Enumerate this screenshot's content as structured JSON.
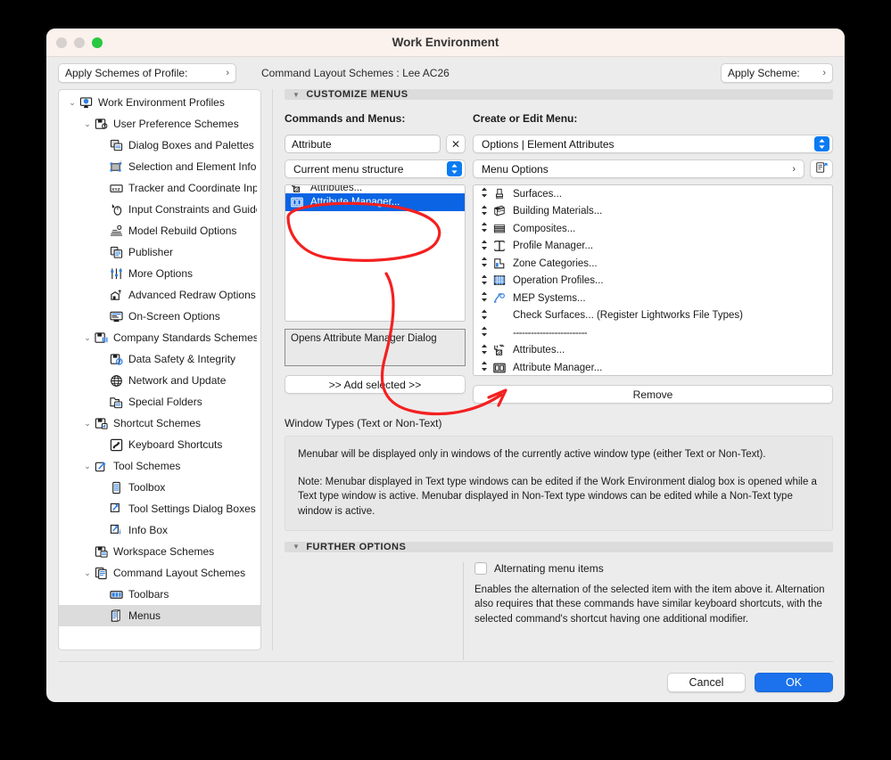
{
  "window": {
    "title": "Work Environment",
    "traffic_lights": [
      "close-gray",
      "minimize-gray",
      "zoom-green"
    ]
  },
  "toolbar": {
    "apply_profile_label": "Apply Schemes of Profile:",
    "apply_scheme_label": "Apply Scheme:",
    "scheme_breadcrumb": "Command Layout Schemes :  Lee AC26",
    "chevron": "›"
  },
  "sidebar": {
    "items": [
      {
        "label": "Work Environment Profiles",
        "indent": 0,
        "disclosure": "⌄",
        "icon": "work-environment-profiles-icon",
        "selected": false
      },
      {
        "label": "User Preference Schemes",
        "indent": 1,
        "disclosure": "⌄",
        "icon": "user-preference-schemes-icon",
        "selected": false
      },
      {
        "label": "Dialog Boxes and Palettes",
        "indent": 2,
        "disclosure": "",
        "icon": "dialog-boxes-palettes-icon",
        "selected": false
      },
      {
        "label": "Selection and Element Information",
        "indent": 2,
        "disclosure": "",
        "icon": "selection-element-info-icon",
        "selected": false
      },
      {
        "label": "Tracker and Coordinate Input",
        "indent": 2,
        "disclosure": "",
        "icon": "tracker-coordinate-input-icon",
        "selected": false
      },
      {
        "label": "Input Constraints and Guides",
        "indent": 2,
        "disclosure": "",
        "icon": "input-constraints-guides-icon",
        "selected": false
      },
      {
        "label": "Model Rebuild Options",
        "indent": 2,
        "disclosure": "",
        "icon": "model-rebuild-options-icon",
        "selected": false
      },
      {
        "label": "Publisher",
        "indent": 2,
        "disclosure": "",
        "icon": "publisher-icon",
        "selected": false
      },
      {
        "label": "More Options",
        "indent": 2,
        "disclosure": "",
        "icon": "more-options-icon",
        "selected": false
      },
      {
        "label": "Advanced Redraw Options",
        "indent": 2,
        "disclosure": "",
        "icon": "advanced-redraw-options-icon",
        "selected": false
      },
      {
        "label": "On-Screen Options",
        "indent": 2,
        "disclosure": "",
        "icon": "on-screen-options-icon",
        "selected": false
      },
      {
        "label": "Company Standards Schemes",
        "indent": 1,
        "disclosure": "⌄",
        "icon": "company-standards-schemes-icon",
        "selected": false
      },
      {
        "label": "Data Safety & Integrity",
        "indent": 2,
        "disclosure": "",
        "icon": "data-safety-integrity-icon",
        "selected": false
      },
      {
        "label": "Network and Update",
        "indent": 2,
        "disclosure": "",
        "icon": "network-update-icon",
        "selected": false
      },
      {
        "label": "Special Folders",
        "indent": 2,
        "disclosure": "",
        "icon": "special-folders-icon",
        "selected": false
      },
      {
        "label": "Shortcut Schemes",
        "indent": 1,
        "disclosure": "⌄",
        "icon": "shortcut-schemes-icon",
        "selected": false
      },
      {
        "label": "Keyboard Shortcuts",
        "indent": 2,
        "disclosure": "",
        "icon": "keyboard-shortcuts-icon",
        "selected": false
      },
      {
        "label": "Tool Schemes",
        "indent": 1,
        "disclosure": "⌄",
        "icon": "tool-schemes-icon",
        "selected": false
      },
      {
        "label": "Toolbox",
        "indent": 2,
        "disclosure": "",
        "icon": "toolbox-icon",
        "selected": false
      },
      {
        "label": "Tool Settings Dialog Boxes",
        "indent": 2,
        "disclosure": "",
        "icon": "tool-settings-dialog-boxes-icon",
        "selected": false
      },
      {
        "label": "Info Box",
        "indent": 2,
        "disclosure": "",
        "icon": "info-box-icon",
        "selected": false
      },
      {
        "label": "Workspace Schemes",
        "indent": 1,
        "disclosure": "",
        "icon": "workspace-schemes-icon",
        "selected": false
      },
      {
        "label": "Command Layout Schemes",
        "indent": 1,
        "disclosure": "⌄",
        "icon": "command-layout-schemes-icon",
        "selected": false
      },
      {
        "label": "Toolbars",
        "indent": 2,
        "disclosure": "",
        "icon": "toolbars-icon",
        "selected": false
      },
      {
        "label": "Menus",
        "indent": 2,
        "disclosure": "",
        "icon": "menus-icon",
        "selected": true
      }
    ]
  },
  "customize_menus": {
    "section_title": "CUSTOMIZE MENUS",
    "triangle": "▼",
    "commands_title": "Commands and Menus:",
    "create_edit_title": "Create or Edit Menu:",
    "search_value": "Attribute",
    "search_placeholder": "",
    "clear_icon": "✕",
    "structure_select": "Current menu structure",
    "menu_select": "Options | Element Attributes",
    "menu_options_label": "Menu Options",
    "menu_options_chevron": "›",
    "new_menu_icon": "new-menu-icon",
    "command_list": [
      {
        "label": "Attributes...",
        "icon": "attributes-icon",
        "selected": false,
        "clipped": true
      },
      {
        "label": "Attribute Manager...",
        "icon": "attribute-manager-icon",
        "selected": true,
        "clipped": false
      }
    ],
    "description": "Opens Attribute Manager Dialog",
    "add_selected_label": ">> Add selected >>",
    "remove_label": "Remove",
    "menu_items": [
      {
        "label": "Surfaces...",
        "icon": "surfaces-icon",
        "separator": false
      },
      {
        "label": "Building Materials...",
        "icon": "building-materials-icon",
        "separator": false
      },
      {
        "label": "Composites...",
        "icon": "composites-icon",
        "separator": false
      },
      {
        "label": "Profile Manager...",
        "icon": "profile-manager-icon",
        "separator": false
      },
      {
        "label": "Zone Categories...",
        "icon": "zone-categories-icon",
        "separator": false
      },
      {
        "label": "Operation Profiles...",
        "icon": "operation-profiles-icon",
        "separator": false
      },
      {
        "label": "MEP Systems...",
        "icon": "mep-systems-icon",
        "separator": false
      },
      {
        "label": "Check Surfaces... (Register Lightworks File Types)",
        "icon": "",
        "separator": false
      },
      {
        "label": "-------------------------",
        "icon": "",
        "separator": true
      },
      {
        "label": "Attributes...",
        "icon": "attributes-icon",
        "separator": false
      },
      {
        "label": "Attribute Manager...",
        "icon": "attribute-manager-icon",
        "separator": false
      }
    ],
    "window_types_label": "Window Types (Text or Non-Text)",
    "window_types_para1": "Menubar will be displayed only in windows of the currently active window type (either Text or Non-Text).",
    "window_types_para2": "Note: Menubar displayed in Text type windows can be edited if the Work Environment dialog box is opened while a Text type window is active. Menubar displayed in Non-Text type windows can be edited while a Non-Text type window is active."
  },
  "further_options": {
    "section_title": "FURTHER OPTIONS",
    "triangle": "▼",
    "checkbox_label": "Alternating menu items",
    "checkbox_checked": false,
    "description": "Enables the alternation of the selected item with the item above it. Alternation also requires that these commands have similar keyboard shortcuts, with the selected command's shortcut having one additional modifier."
  },
  "footer": {
    "cancel_label": "Cancel",
    "ok_label": "OK"
  },
  "annotations": {
    "color": "#f42020",
    "ellipse_target": "Attribute Manager... (command list)",
    "arrow_target": "Attribute Manager... (menu list)"
  }
}
